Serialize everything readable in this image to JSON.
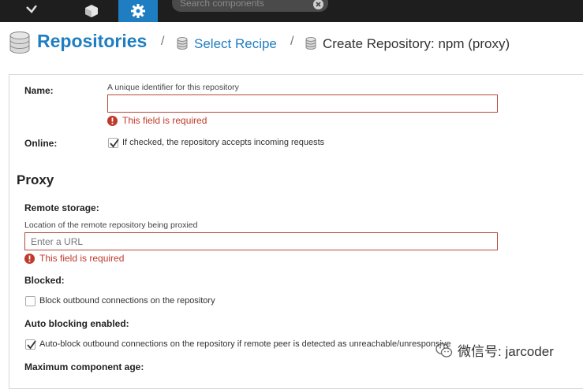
{
  "topbar": {
    "search_placeholder": "Search components"
  },
  "breadcrumb": {
    "title": "Repositories",
    "separator1": "/",
    "link": "Select Recipe",
    "separator2": "/",
    "current": "Create Repository: npm (proxy)"
  },
  "form": {
    "name": {
      "label": "Name:",
      "help": "A unique identifier for this repository",
      "value": "",
      "error": "This field is required"
    },
    "online": {
      "label": "Online:",
      "checked": true,
      "text": "If checked, the repository accepts incoming requests"
    },
    "proxy": {
      "title": "Proxy",
      "remote_storage": {
        "label": "Remote storage:",
        "help": "Location of the remote repository being proxied",
        "placeholder": "Enter a URL",
        "error": "This field is required"
      },
      "blocked": {
        "label": "Blocked:",
        "checked": false,
        "text": "Block outbound connections on the repository"
      },
      "auto_blocking": {
        "label": "Auto blocking enabled:",
        "checked": true,
        "text": "Auto-block outbound connections on the repository if remote peer is detected as unreachable/unresponsive"
      },
      "max_age": {
        "label": "Maximum component age:"
      }
    }
  },
  "watermark": {
    "text": "微信号: jarcoder"
  },
  "colors": {
    "accent": "#1f7ec2",
    "error": "#c0392b",
    "topbar": "#1e1e1e"
  }
}
